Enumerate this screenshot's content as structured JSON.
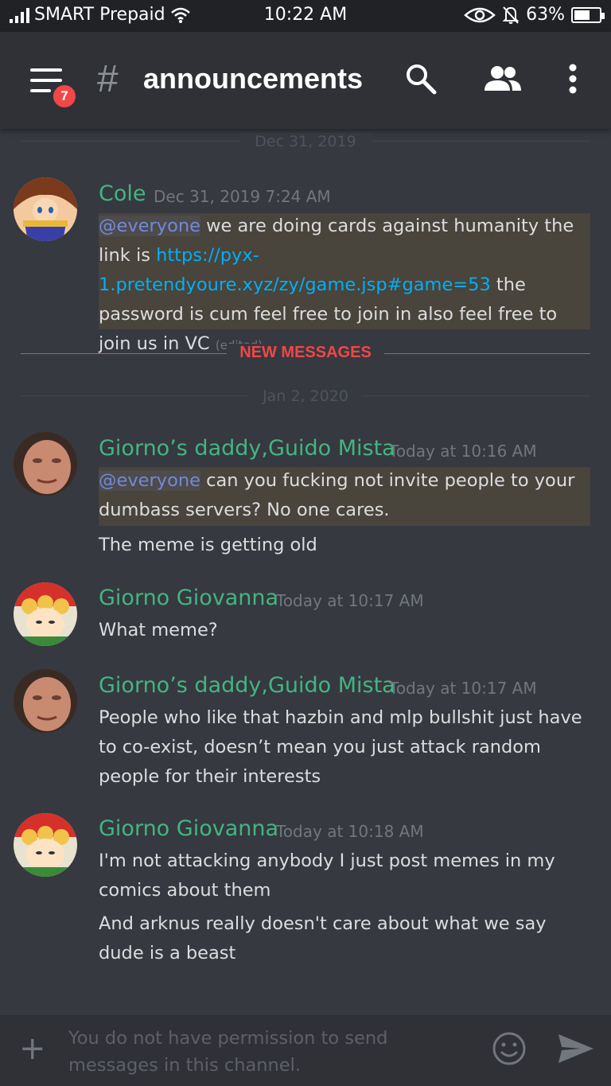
{
  "status_bar": {
    "carrier": "SMART Prepaid",
    "time": "10:22 AM",
    "battery": "63%",
    "battery_level": 0.63
  },
  "header": {
    "unread_badge": "7",
    "hash": "#",
    "channel_name": "announcements",
    "icons": [
      "menu-icon",
      "search-icon",
      "members-icon",
      "more-options-icon"
    ]
  },
  "dividers": {
    "date1": "Dec 31, 2019",
    "new_messages": "NEW MESSAGES",
    "date2": "Jan 2, 2020"
  },
  "messages": [
    {
      "author": "Cole",
      "timestamp": "Dec 31, 2019 7:24 AM",
      "mention": "@everyone",
      "text_a": " we are doing cards against humanity the link is ",
      "link": "https://pyx-1.pretendyoure.xyz/zy/game.jsp#game=53",
      "text_b": " the password is cum feel free to join in also feel free to join us in VC ",
      "edited": "(edited)"
    },
    {
      "author": "Giorno’s daddy,Guido Mista",
      "timestamp": "Today at 10:16 AM",
      "mention": "@everyone",
      "text": " can you fucking not invite people to your dumbass servers? No one cares.",
      "followup": "The meme is getting old"
    },
    {
      "author": "Giorno Giovanna",
      "timestamp": "Today at 10:17 AM",
      "text": "What meme?"
    },
    {
      "author": "Giorno’s daddy,Guido Mista",
      "timestamp": "Today at 10:17 AM",
      "text": "People who like that hazbin and mlp bullshit just have to co-exist, doesn’t mean you just attack random people for their interests"
    },
    {
      "author": "Giorno Giovanna",
      "timestamp": "Today at 10:18 AM",
      "text": "I'm not attacking anybody I just post memes in my comics about them",
      "followup": "And arknus really doesn't care about what we say dude is a beast"
    }
  ],
  "input": {
    "placeholder": "You do not have permission to send messages in this channel."
  },
  "colors": {
    "background": "#36393f",
    "header": "#2f3136",
    "username_green": "#43b581",
    "mention_blue": "#7289da",
    "link_blue": "#00b0f4",
    "new_messages_red": "#f04747",
    "mention_highlight": "#49443c"
  }
}
